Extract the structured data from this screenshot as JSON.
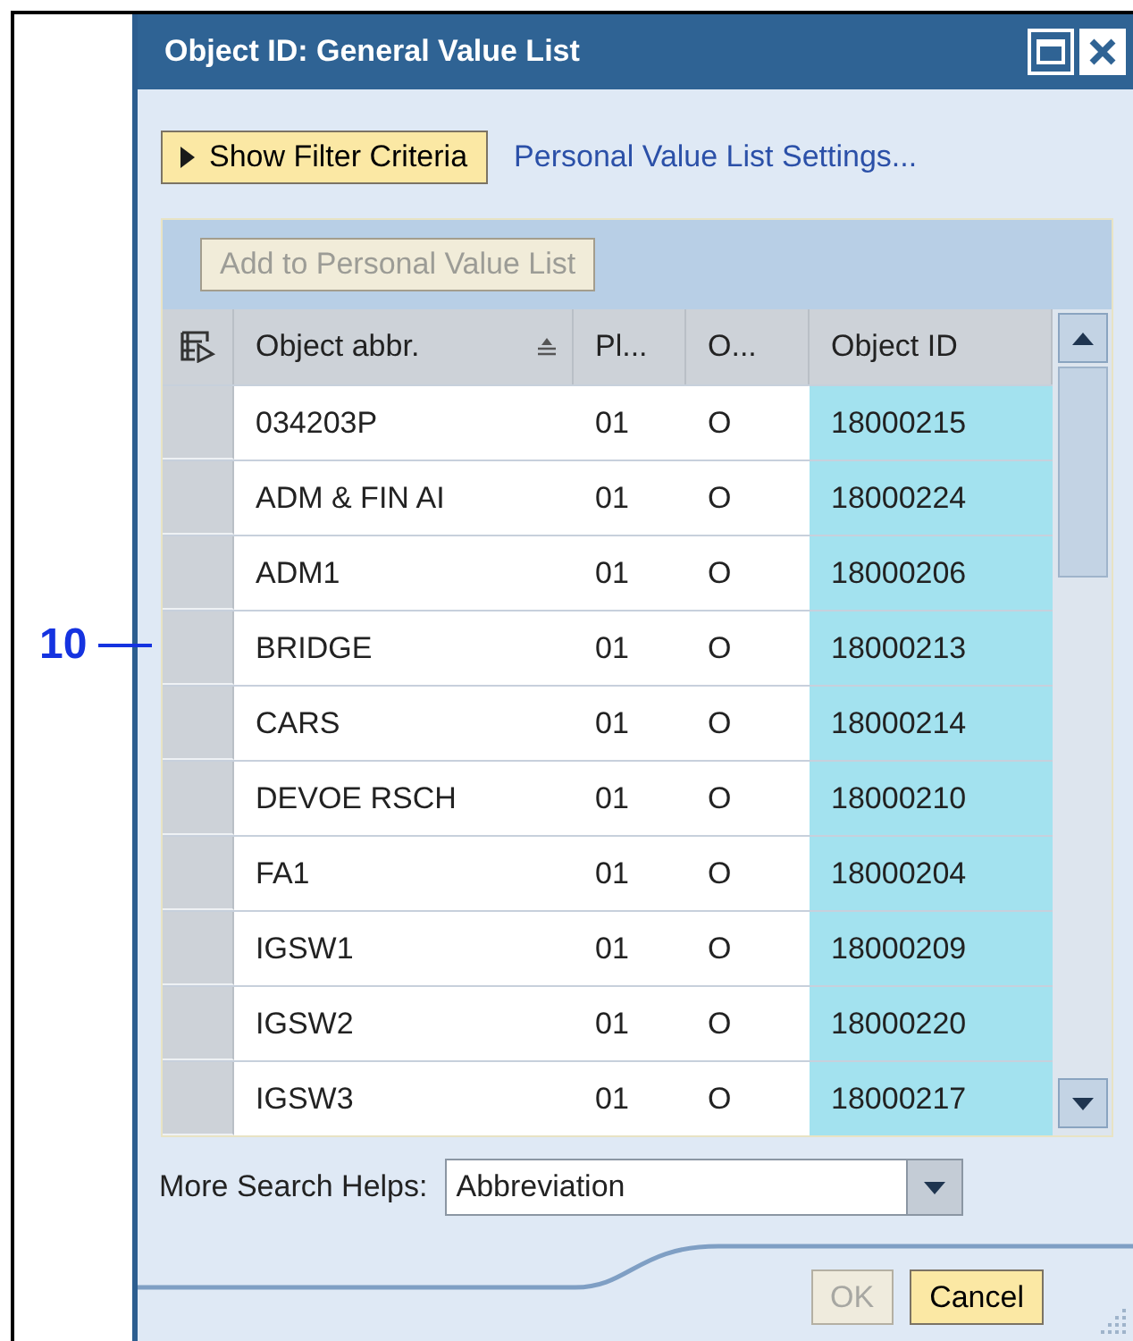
{
  "callout": {
    "label": "10"
  },
  "window": {
    "title": "Object ID: General Value List"
  },
  "filter_button": {
    "label": "Show Filter Criteria"
  },
  "settings_link": {
    "label": "Personal Value List Settings..."
  },
  "add_button": {
    "label": "Add to Personal Value List",
    "disabled": true
  },
  "table": {
    "columns": [
      {
        "label": "Object abbr.",
        "sorted": true,
        "key": false
      },
      {
        "label": "Pl...",
        "sorted": false,
        "key": false
      },
      {
        "label": "O...",
        "sorted": false,
        "key": false
      },
      {
        "label": "Object ID",
        "sorted": false,
        "key": true
      }
    ],
    "rows": [
      {
        "cells": [
          "034203P",
          "01",
          "O",
          "18000215"
        ]
      },
      {
        "cells": [
          "ADM & FIN AI",
          "01",
          "O",
          "18000224"
        ]
      },
      {
        "cells": [
          "ADM1",
          "01",
          "O",
          "18000206"
        ]
      },
      {
        "cells": [
          "BRIDGE",
          "01",
          "O",
          "18000213"
        ]
      },
      {
        "cells": [
          "CARS",
          "01",
          "O",
          "18000214"
        ]
      },
      {
        "cells": [
          "DEVOE RSCH",
          "01",
          "O",
          "18000210"
        ]
      },
      {
        "cells": [
          "FA1",
          "01",
          "O",
          "18000204"
        ]
      },
      {
        "cells": [
          "IGSW1",
          "01",
          "O",
          "18000209"
        ]
      },
      {
        "cells": [
          "IGSW2",
          "01",
          "O",
          "18000220"
        ]
      },
      {
        "cells": [
          "IGSW3",
          "01",
          "O",
          "18000217"
        ]
      }
    ]
  },
  "search_helps": {
    "label": "More Search Helps:",
    "value": "Abbreviation"
  },
  "buttons": [
    {
      "label": "OK",
      "disabled": true
    },
    {
      "label": "Cancel",
      "disabled": false
    }
  ]
}
